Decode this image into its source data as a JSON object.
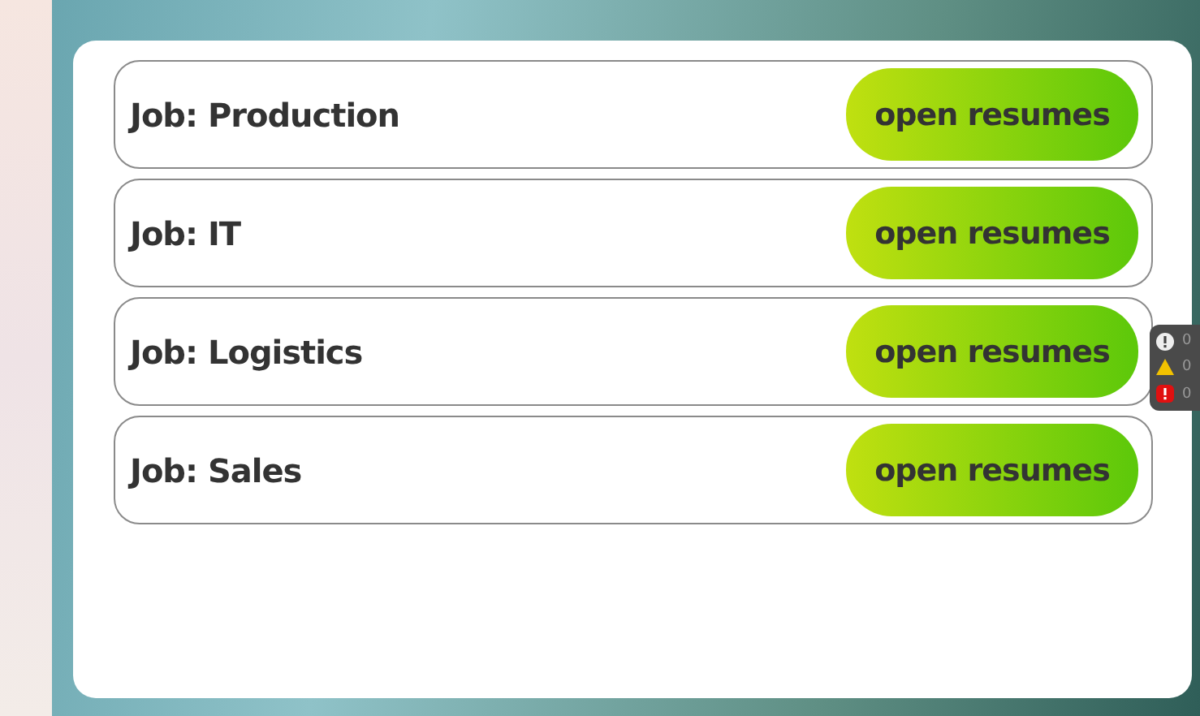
{
  "jobs": [
    {
      "title": "Job: Production",
      "button": "open resumes"
    },
    {
      "title": "Job: IT",
      "button": "open resumes"
    },
    {
      "title": "Job: Logistics",
      "button": "open resumes"
    },
    {
      "title": "Job: Sales",
      "button": "open resumes"
    }
  ],
  "status_counts": [
    {
      "kind": "info",
      "count": "0"
    },
    {
      "kind": "warning",
      "count": "0"
    },
    {
      "kind": "error",
      "count": "0"
    }
  ]
}
